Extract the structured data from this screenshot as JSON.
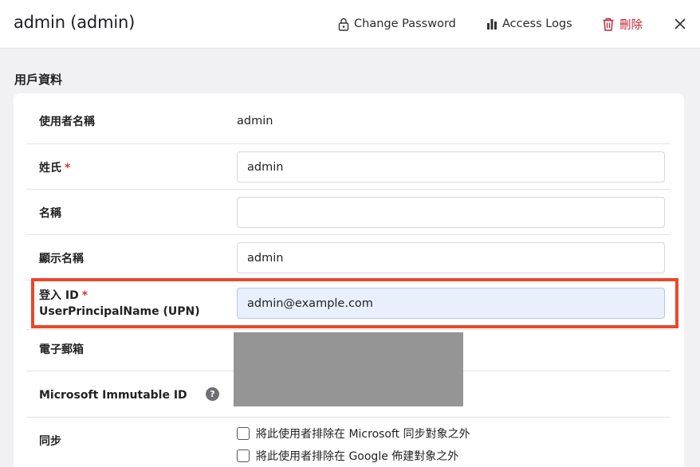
{
  "header": {
    "title": "admin (admin)",
    "change_password": "Change Password",
    "access_logs": "Access Logs",
    "delete": "刪除"
  },
  "section": {
    "title": "用戶資料"
  },
  "fields": {
    "username": {
      "label": "使用者名稱",
      "value": "admin"
    },
    "last_name": {
      "label": "姓氏",
      "required": "*",
      "value": "admin"
    },
    "first_name": {
      "label": "名稱",
      "value": ""
    },
    "display_name": {
      "label": "顯示名稱",
      "value": "admin"
    },
    "login_id": {
      "label": "登入 ID",
      "required": "*",
      "sublabel": "UserPrincipalName (UPN)",
      "value": "admin@example.com"
    },
    "email": {
      "label": "電子郵箱"
    },
    "immutable_id": {
      "label": "Microsoft Immutable ID",
      "help": "?"
    },
    "sync": {
      "label": "同步",
      "options": [
        "將此使用者排除在 Microsoft 同步對象之外",
        "將此使用者排除在 Google 佈建對象之外"
      ]
    }
  },
  "colors": {
    "accent_red": "#c0283a",
    "highlight_border": "#e8482a",
    "input_highlight": "#e8effd"
  }
}
